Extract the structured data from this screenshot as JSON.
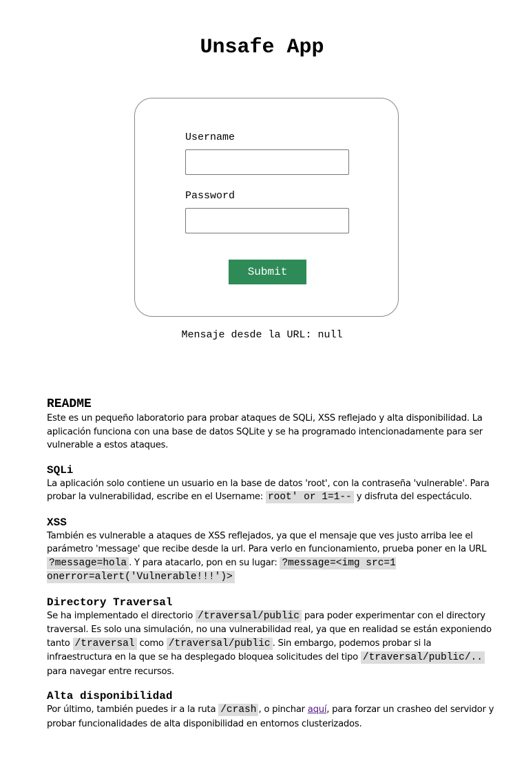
{
  "header": {
    "title": "Unsafe App"
  },
  "login": {
    "username_label": "Username",
    "username_value": "",
    "password_label": "Password",
    "password_value": "",
    "submit_label": "Submit"
  },
  "message": {
    "label": "Mensaje desde la URL: ",
    "value": "null"
  },
  "readme": {
    "title": "README",
    "intro": "Este es un pequeño laboratorio para probar ataques de SQLi, XSS reflejado y alta disponibilidad. La aplicación funciona con una base de datos SQLite y se ha programado intencionadamente para ser vulnerable a estos ataques.",
    "sqli": {
      "title": "SQLi",
      "text_1": "La aplicación solo contiene un usuario en la base de datos 'root', con la contraseña 'vulnerable'. Para probar la vulnerabilidad, escribe en el Username: ",
      "code_1": "root' or 1=1--",
      "text_2": " y disfruta del espectáculo."
    },
    "xss": {
      "title": "XSS",
      "text_1": "También es vulnerable a ataques de XSS reflejados, ya que el mensaje que ves justo arriba lee el parámetro 'message' que recibe desde la url. Para verlo en funcionamiento, prueba poner en la URL ",
      "code_1": "?message=hola",
      "text_2": ". Y para atacarlo, pon en su lugar: ",
      "code_2": "?message=<img src=1 onerror=alert('Vulnerable!!!')>"
    },
    "traversal": {
      "title": "Directory Traversal",
      "text_1": "Se ha implementado el directorio ",
      "code_1": "/traversal/public",
      "text_2": " para poder experimentar con el directory traversal. Es solo una simulación, no una vulnerabilidad real, ya que en realidad se están exponiendo tanto ",
      "code_2": "/traversal",
      "text_3": " como ",
      "code_3": "/traversal/public",
      "text_4": ". Sin embargo, podemos probar si la infraestructura en la que se ha desplegado bloquea solicitudes del tipo ",
      "code_4": "/traversal/public/..",
      "text_5": " para navegar entre recursos."
    },
    "availability": {
      "title": "Alta disponibilidad",
      "text_1": "Por último, también puedes ir a la ruta ",
      "code_1": "/crash",
      "text_2": ", o pinchar ",
      "link": "aquí",
      "text_3": ", para forzar un crasheo del servidor y probar funcionalidades de alta disponibilidad en entornos clusterizados."
    }
  },
  "colors": {
    "submit_bg": "#2e8b57",
    "code_bg": "#dcdcdc",
    "link_visited": "#551a8b"
  }
}
